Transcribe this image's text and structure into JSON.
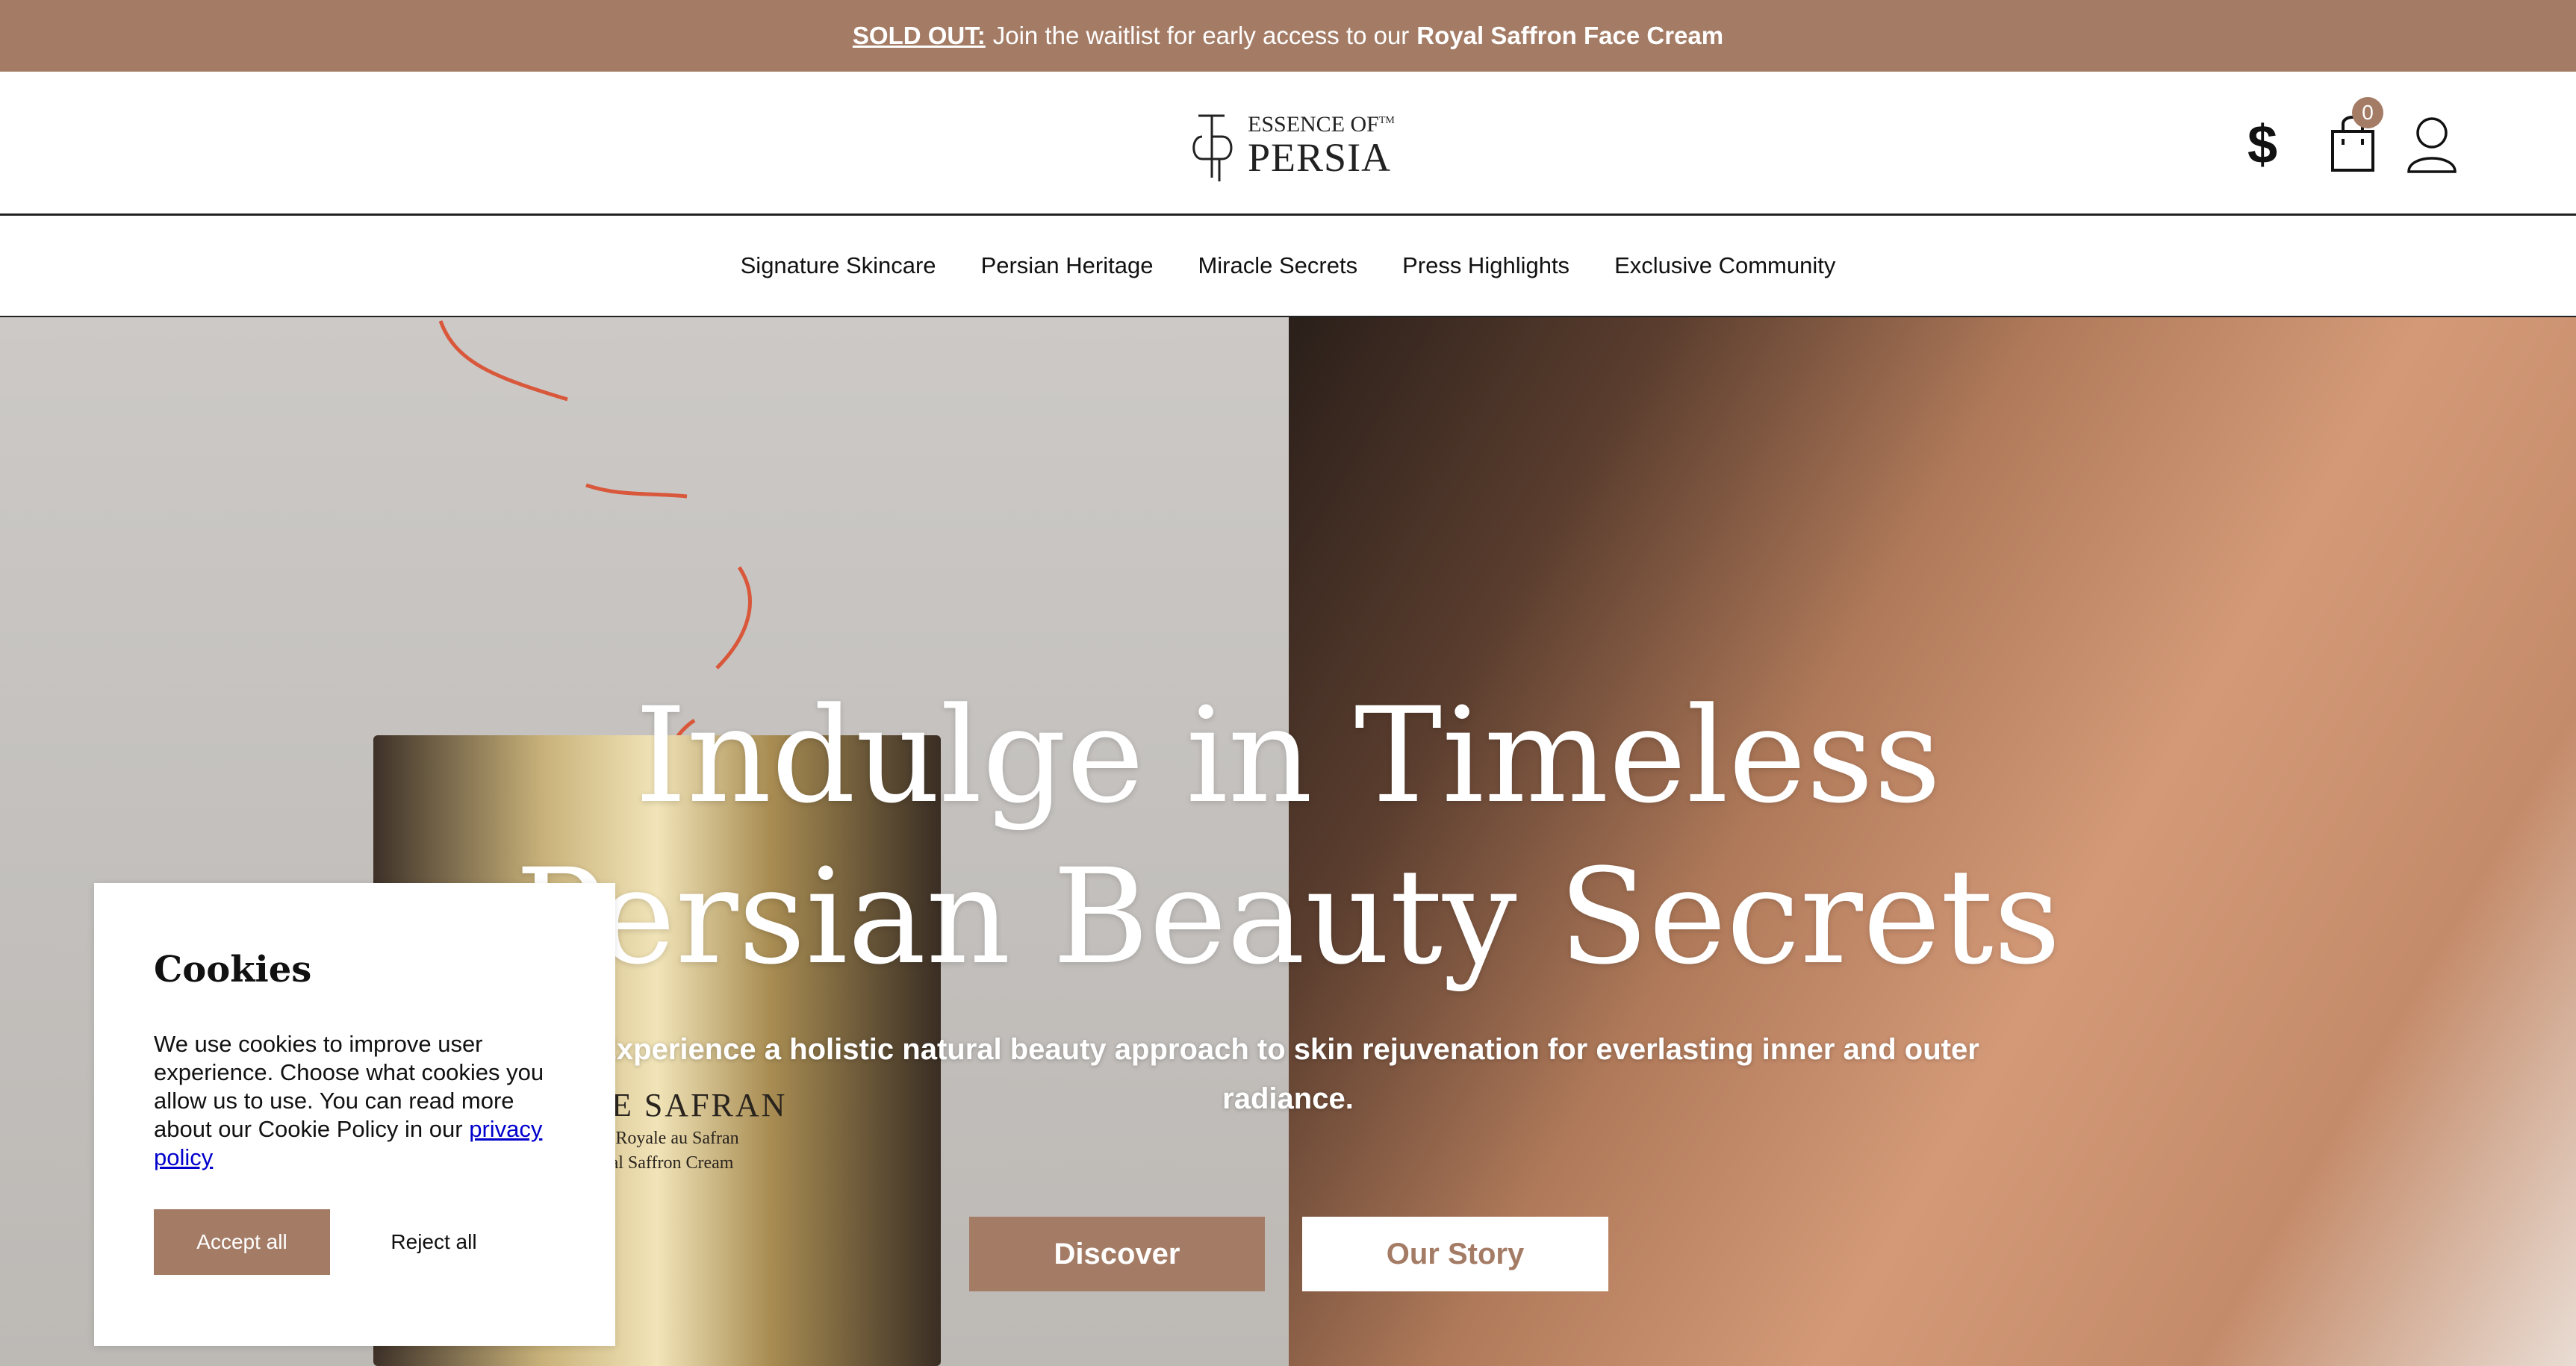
{
  "announcement": {
    "sold_label": "SOLD OUT:",
    "message": "Join the waitlist for early access to our",
    "product": "Royal Saffron Face Cream"
  },
  "header": {
    "logo": {
      "line1": "ESSENCE OF",
      "tm": "TM",
      "line2": "PERSIA"
    },
    "currency_symbol": "$",
    "cart_count": "0"
  },
  "nav": {
    "items": [
      {
        "label": "Signature Skincare"
      },
      {
        "label": "Persian Heritage"
      },
      {
        "label": "Miracle Secrets"
      },
      {
        "label": "Press Highlights"
      },
      {
        "label": "Exclusive Community"
      }
    ]
  },
  "hero": {
    "title_line1": "Indulge in Timeless",
    "title_line2": "Persian Beauty Secrets",
    "subtitle": "Experience a holistic natural beauty approach to skin rejuvenation for everlasting inner and outer radiance.",
    "primary_button": "Discover",
    "secondary_button": "Our Story",
    "jar_label_big": "NE DE SAFRAN",
    "jar_label_small1": "rème Royale au Safran",
    "jar_label_small2": "Royal Saffron Cream"
  },
  "cookie": {
    "title": "Cookies",
    "text": "We use cookies to improve user experience. Choose what cookies you allow us to use. You can read more about our Cookie Policy in our",
    "link": "privacy policy",
    "accept": "Accept all",
    "reject": "Reject all"
  },
  "colors": {
    "brand": "#a47c66",
    "link": "#0000cc"
  }
}
